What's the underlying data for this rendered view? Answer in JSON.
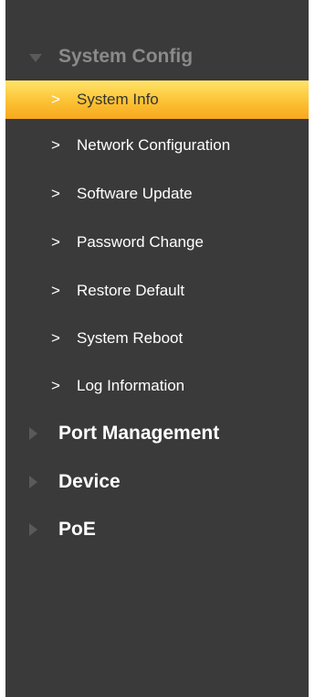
{
  "sidebar": {
    "sections": [
      {
        "label": "System Config",
        "expanded": true,
        "items": [
          {
            "label": "System Info",
            "active": true
          },
          {
            "label": "Network Configuration",
            "active": false
          },
          {
            "label": "Software Update",
            "active": false
          },
          {
            "label": "Password Change",
            "active": false
          },
          {
            "label": "Restore Default",
            "active": false
          },
          {
            "label": "System Reboot",
            "active": false
          },
          {
            "label": "Log Information",
            "active": false
          }
        ]
      },
      {
        "label": "Port Management",
        "expanded": false
      },
      {
        "label": "Device",
        "expanded": false
      },
      {
        "label": "PoE",
        "expanded": false
      }
    ],
    "item_marker": ">",
    "colors": {
      "background": "#3a3a3a",
      "active_item": "#fcc234",
      "expanded_header_text": "#8a8a8a",
      "collapsed_header_text": "#ffffff"
    }
  }
}
